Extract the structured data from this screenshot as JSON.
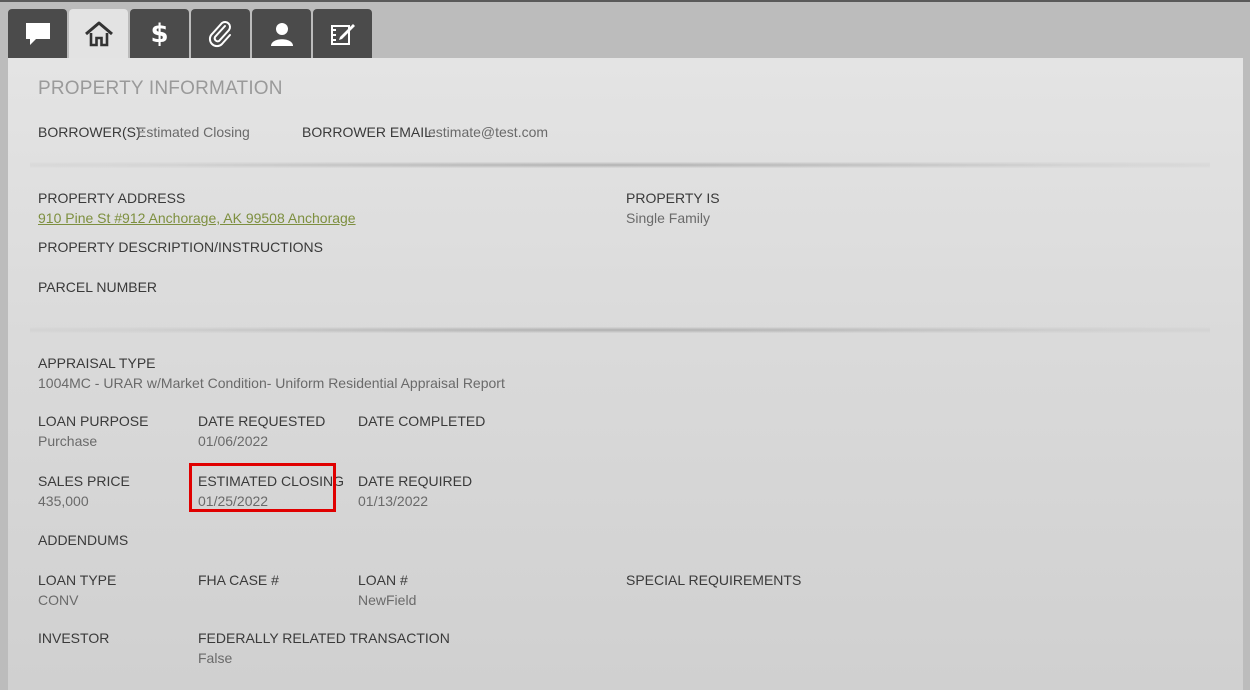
{
  "tabs": [
    {
      "icon": "comment-icon",
      "active": false
    },
    {
      "icon": "home-icon",
      "active": true
    },
    {
      "icon": "dollar-icon",
      "glyph": "$",
      "active": false
    },
    {
      "icon": "paperclip-icon",
      "active": false
    },
    {
      "icon": "user-icon",
      "active": false
    },
    {
      "icon": "edit-icon",
      "active": false
    }
  ],
  "section_title": "PROPERTY INFORMATION",
  "borrower": {
    "label": "BORROWER(S):",
    "value": "Estimated Closing"
  },
  "borrower_email": {
    "label": "BORROWER EMAIL:",
    "value": "estimate@test.com"
  },
  "property_address": {
    "label": "PROPERTY ADDRESS",
    "value": "910 Pine St #912 Anchorage, AK 99508 Anchorage"
  },
  "property_is": {
    "label": "PROPERTY IS",
    "value": "Single Family"
  },
  "property_description": {
    "label": "PROPERTY DESCRIPTION/INSTRUCTIONS"
  },
  "parcel_number": {
    "label": "PARCEL NUMBER"
  },
  "appraisal_type": {
    "label": "APPRAISAL TYPE",
    "value": "1004MC - URAR w/Market Condition- Uniform Residential Appraisal Report"
  },
  "loan_purpose": {
    "label": "LOAN PURPOSE",
    "value": "Purchase"
  },
  "date_requested": {
    "label": "DATE REQUESTED",
    "value": "01/06/2022"
  },
  "date_completed": {
    "label": "DATE COMPLETED"
  },
  "sales_price": {
    "label": "SALES PRICE",
    "value": "435,000"
  },
  "estimated_closing": {
    "label": "ESTIMATED CLOSING",
    "value": "01/25/2022"
  },
  "date_required": {
    "label": "DATE REQUIRED",
    "value": "01/13/2022"
  },
  "addendums": {
    "label": "ADDENDUMS"
  },
  "loan_type": {
    "label": "LOAN TYPE",
    "value": "CONV"
  },
  "fha_case": {
    "label": "FHA CASE #"
  },
  "loan_number": {
    "label": "LOAN #",
    "value": "NewField"
  },
  "special_requirements": {
    "label": "SPECIAL REQUIREMENTS"
  },
  "investor": {
    "label": "INVESTOR"
  },
  "federally_related": {
    "label": "FEDERALLY RELATED TRANSACTION",
    "value": "False"
  },
  "colors": {
    "link": "#7d8f3f",
    "highlight": "#e00000",
    "tab_bg": "#4b4b4b",
    "tab_active_bg": "#e3e3e3"
  }
}
